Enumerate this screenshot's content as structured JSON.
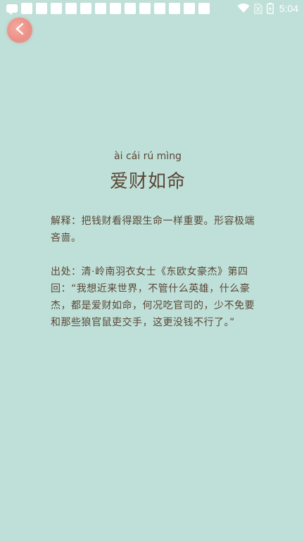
{
  "status_bar": {
    "time": "5:04",
    "notification_icons": [
      "chat-icon",
      "box",
      "box",
      "box",
      "box",
      "box",
      "box",
      "box",
      "box",
      "box",
      "box",
      "box",
      "box",
      "box"
    ],
    "system_icons": [
      "wifi-icon",
      "sim-icon",
      "battery-icon"
    ],
    "icon_color": "#ffffff"
  },
  "idiom": {
    "pinyin": "ài cái rú mìng",
    "title": "爱财如命",
    "explanation": "解释：把钱财看得跟生命一样重要。形容极端吝啬。",
    "source": "出处：清·岭南羽衣女士《东欧女豪杰》第四回：“我想近来世界，不管什么英雄，什么豪杰，都是爱财如命，何况吃官司的，少不免要和那些狼官鼠吏交手，这更没钱不行了。”"
  },
  "theme": {
    "background": "#bfe0d8",
    "text": "#5a4636",
    "back_button": "#ea8f86"
  }
}
